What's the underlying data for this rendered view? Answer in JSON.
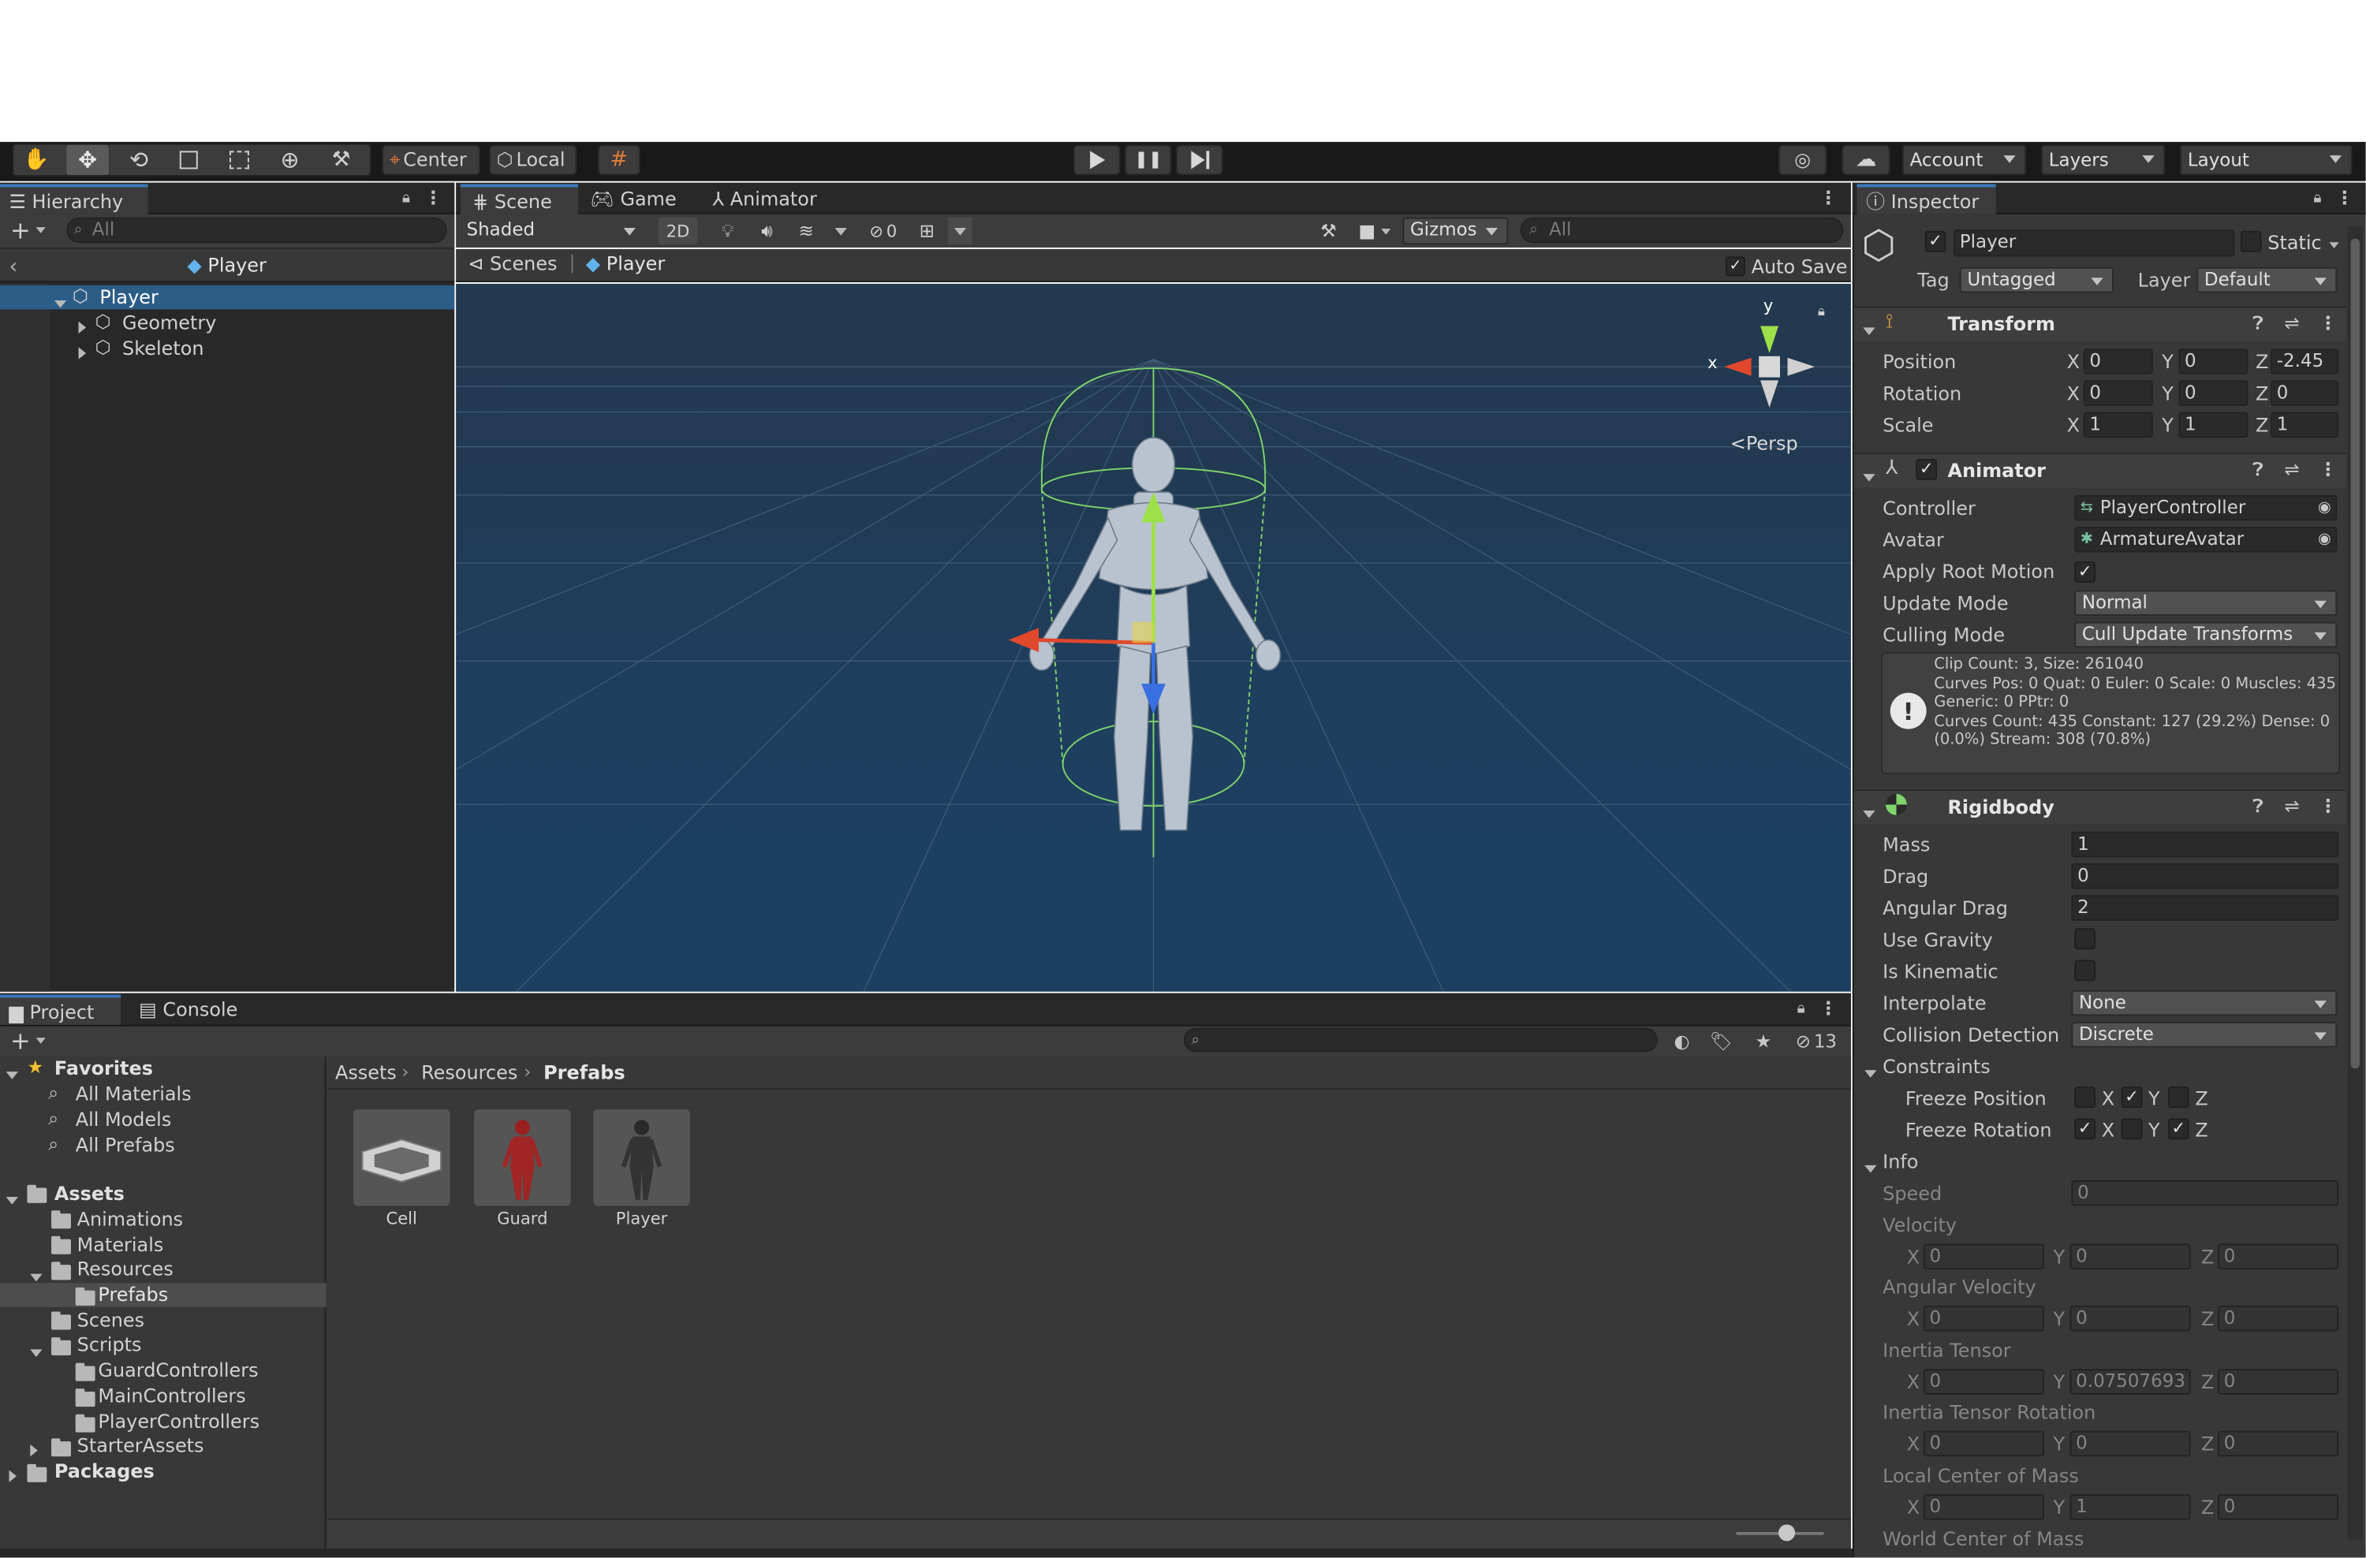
{
  "toolbar": {
    "center_label": "Center",
    "local_label": "Local",
    "account": "Account",
    "layers": "Layers",
    "layout": "Layout"
  },
  "hierarchy": {
    "tab": "Hierarchy",
    "search_placeholder": "All",
    "root_title": "Player",
    "items": [
      {
        "label": "Player"
      },
      {
        "label": "Geometry"
      },
      {
        "label": "Skeleton"
      }
    ]
  },
  "scene": {
    "tabs": [
      "Scene",
      "Game",
      "Animator"
    ],
    "shading": "Shaded",
    "mode_2d": "2D",
    "hidden_count": "0",
    "gizmos": "Gizmos",
    "search_placeholder": "All",
    "breadcrumb_scenes": "Scenes",
    "breadcrumb_player": "Player",
    "auto_save": "Auto Save",
    "persp": "Persp",
    "axis_y": "y",
    "axis_x": "x"
  },
  "project": {
    "tabs": [
      "Project",
      "Console"
    ],
    "hidden_count": "13",
    "favorites": "Favorites",
    "fav_items": [
      "All Materials",
      "All Models",
      "All Prefabs"
    ],
    "assets": "Assets",
    "folders": [
      "Animations",
      "Materials",
      "Resources",
      "Prefabs",
      "Scenes",
      "Scripts",
      "GuardControllers",
      "MainControllers",
      "PlayerControllers",
      "StarterAssets"
    ],
    "packages": "Packages",
    "breadcrumb": [
      "Assets",
      "Resources",
      "Prefabs"
    ],
    "prefabs": [
      "Cell",
      "Guard",
      "Player"
    ]
  },
  "inspector": {
    "tab": "Inspector",
    "object_name": "Player",
    "static_label": "Static",
    "tag_label": "Tag",
    "tag_value": "Untagged",
    "layer_label": "Layer",
    "layer_value": "Default",
    "transform": {
      "title": "Transform",
      "position_label": "Position",
      "rotation_label": "Rotation",
      "scale_label": "Scale",
      "position": [
        "0",
        "0",
        "-2.45"
      ],
      "rotation": [
        "0",
        "0",
        "0"
      ],
      "scale": [
        "1",
        "1",
        "1"
      ]
    },
    "animator": {
      "title": "Animator",
      "controller_label": "Controller",
      "controller_value": "PlayerController",
      "avatar_label": "Avatar",
      "avatar_value": "ArmatureAvatar",
      "root_motion_label": "Apply Root Motion",
      "update_mode_label": "Update Mode",
      "update_mode_value": "Normal",
      "culling_mode_label": "Culling Mode",
      "culling_mode_value": "Cull Update Transforms",
      "info_lines": [
        "Clip Count: 3, Size: 261040",
        "Curves Pos: 0 Quat: 0 Euler: 0 Scale: 0 Muscles: 435",
        "Generic: 0 PPtr: 0",
        "Curves Count: 435 Constant: 127 (29.2%) Dense: 0",
        "(0.0%) Stream: 308 (70.8%)"
      ]
    },
    "rigidbody": {
      "title": "Rigidbody",
      "mass_label": "Mass",
      "mass": "1",
      "drag_label": "Drag",
      "drag": "0",
      "angular_drag_label": "Angular Drag",
      "angular_drag": "2",
      "use_gravity_label": "Use Gravity",
      "is_kinematic_label": "Is Kinematic",
      "interpolate_label": "Interpolate",
      "interpolate_value": "None",
      "collision_label": "Collision Detection",
      "collision_value": "Discrete",
      "constraints_label": "Constraints",
      "freeze_position_label": "Freeze Position",
      "freeze_rotation_label": "Freeze Rotation",
      "info_label": "Info",
      "speed_label": "Speed",
      "speed": "0",
      "velocity_label": "Velocity",
      "velocity": [
        "0",
        "0",
        "0"
      ],
      "angular_velocity_label": "Angular Velocity",
      "angular_velocity": [
        "0",
        "0",
        "0"
      ],
      "inertia_tensor_label": "Inertia Tensor",
      "inertia_tensor": [
        "0",
        "0.07507693",
        "0"
      ],
      "inertia_rotation_label": "Inertia Tensor Rotation",
      "inertia_rotation": [
        "0",
        "0",
        "0"
      ],
      "local_com_label": "Local Center of Mass",
      "local_com": [
        "0",
        "1",
        "0"
      ],
      "world_com_label": "World Center of Mass"
    }
  },
  "axes": {
    "x": "X",
    "y": "Y",
    "z": "Z"
  }
}
